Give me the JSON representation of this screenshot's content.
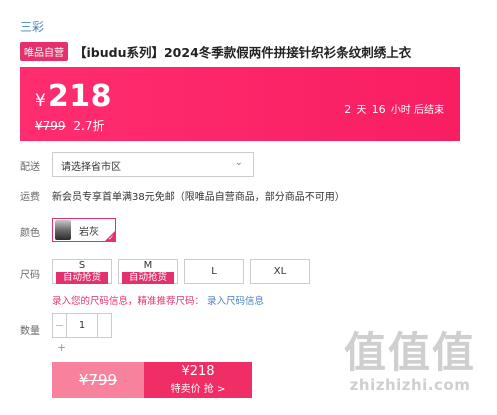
{
  "brand": "三彩",
  "badge": "唯品自营",
  "title": "【ibudu系列】2024冬季款假两件拼接针织衫条纹刺绣上衣",
  "price": {
    "symbol": "¥",
    "current": "218",
    "original": "¥799",
    "discount": "2.7折"
  },
  "countdown": {
    "days": "2",
    "days_unit": "天",
    "hours": "16",
    "hours_unit": "小时",
    "suffix": "后结束"
  },
  "labels": {
    "delivery": "配送",
    "freight": "运费",
    "color": "颜色",
    "size": "尺码",
    "quantity": "数量"
  },
  "region": {
    "placeholder": "请选择省市区"
  },
  "freight_text": "新会员专享首单满38元免邮（限唯品自营商品，部分商品不可用）",
  "color_option": {
    "name": "岩灰",
    "selected": true
  },
  "sizes": [
    {
      "label": "S",
      "tag": "自动抢货"
    },
    {
      "label": "M",
      "tag": "自动抢货"
    },
    {
      "label": "L",
      "tag": ""
    },
    {
      "label": "XL",
      "tag": ""
    }
  ],
  "size_note": {
    "text": "录入您的尺码信息，精准推荐尺码：",
    "link": "录入尺码信息"
  },
  "quantity": {
    "minus": "−",
    "value": "1",
    "plus": "+"
  },
  "buy": {
    "original": "¥799",
    "price": "¥218",
    "label": "特卖价 抢 >"
  },
  "watermark": {
    "glyphs": "值值值",
    "url": "zhizhizhi.com"
  }
}
